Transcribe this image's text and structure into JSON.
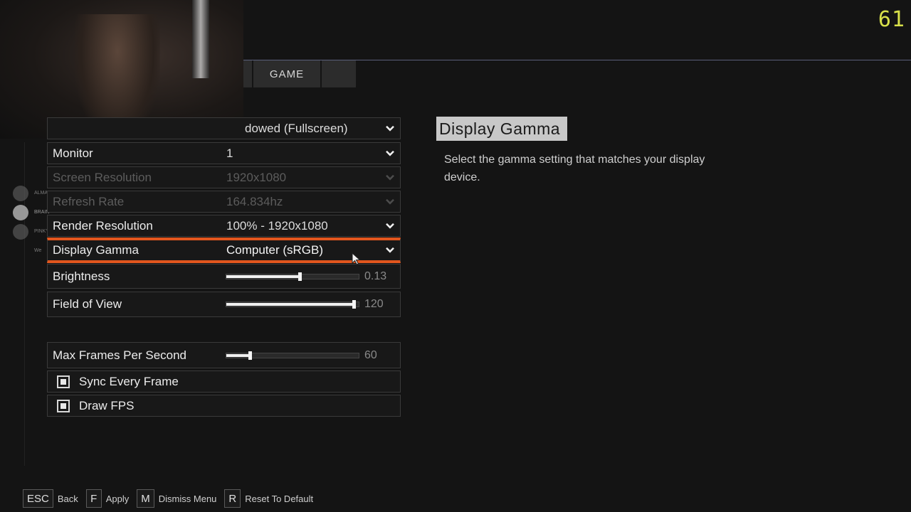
{
  "fps_counter": "61",
  "tabs": {
    "game": "GAME"
  },
  "squad": [
    {
      "name": "ALMAS",
      "active": false
    },
    {
      "name": "BRAIN",
      "active": true
    },
    {
      "name": "PINKY",
      "active": false
    },
    {
      "name": "We",
      "active": false
    }
  ],
  "settings": {
    "display_mode": {
      "value": "dowed (Fullscreen)"
    },
    "monitor": {
      "label": "Monitor",
      "value": "1"
    },
    "screen_resolution": {
      "label": "Screen Resolution",
      "value": "1920x1080",
      "disabled": true
    },
    "refresh_rate": {
      "label": "Refresh Rate",
      "value": "164.834hz",
      "disabled": true
    },
    "render_resolution": {
      "label": "Render Resolution",
      "value": "100% - 1920x1080"
    },
    "display_gamma": {
      "label": "Display Gamma",
      "value": "Computer (sRGB)",
      "selected": true
    },
    "brightness": {
      "label": "Brightness",
      "value": "0.13",
      "fraction": 0.56
    },
    "field_of_view": {
      "label": "Field of View",
      "value": "120",
      "fraction": 0.98
    },
    "max_fps": {
      "label": "Max Frames Per Second",
      "value": "60",
      "fraction": 0.17
    },
    "sync_every_frame": {
      "label": "Sync Every Frame",
      "checked": true
    },
    "draw_fps": {
      "label": "Draw FPS",
      "checked": true
    }
  },
  "description": {
    "title": "Display Gamma",
    "text": "Select the gamma setting that matches your display device."
  },
  "footer": [
    {
      "key": "ESC",
      "action": "Back"
    },
    {
      "key": "F",
      "action": "Apply"
    },
    {
      "key": "M",
      "action": "Dismiss Menu"
    },
    {
      "key": "R",
      "action": "Reset To Default"
    }
  ],
  "colors": {
    "accent": "#e2561e",
    "fps_counter": "#d8e04a",
    "background": "#141414"
  }
}
